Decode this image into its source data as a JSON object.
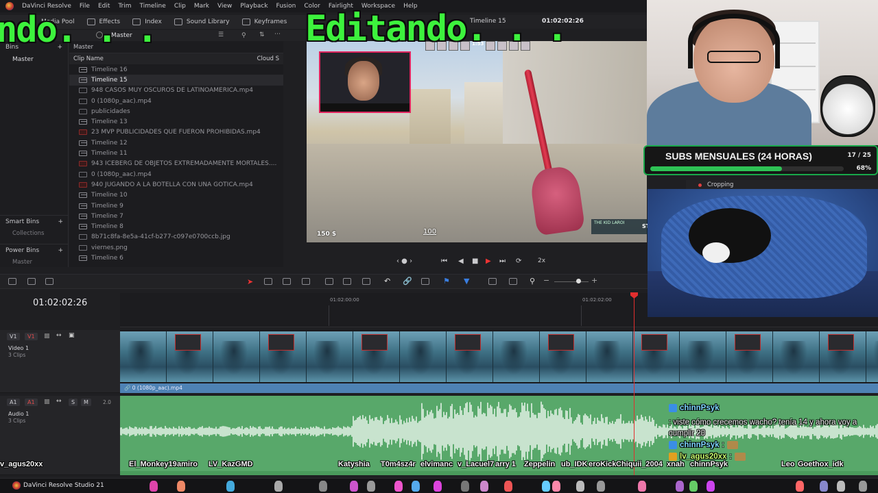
{
  "app": {
    "menu": [
      "DaVinci Resolve",
      "File",
      "Edit",
      "Trim",
      "Timeline",
      "Clip",
      "Mark",
      "View",
      "Playback",
      "Fusion",
      "Color",
      "Fairlight",
      "Workspace",
      "Help"
    ]
  },
  "toolbar": {
    "media_pool": "Media Pool",
    "effects": "Effects",
    "index": "Index",
    "sound_library": "Sound Library",
    "keyframes": "Keyframes"
  },
  "pool": {
    "header": "Master",
    "bins_label": "Bins",
    "master_bin": "Master",
    "smart_bins": "Smart Bins",
    "collections": "Collections",
    "power_bins": "Power Bins",
    "power_master": "Master",
    "crumb": "Master",
    "col_clip_name": "Clip Name",
    "col_cloud": "Cloud S",
    "clips": [
      {
        "name": "Timeline 16",
        "kind": "tl"
      },
      {
        "name": "Timeline 15",
        "kind": "tl",
        "selected": true
      },
      {
        "name": "948 CASOS MUY OSCUROS DE LATINOAMERICA.mp4",
        "kind": "vid"
      },
      {
        "name": "0 (1080p_aac).mp4",
        "kind": "vid"
      },
      {
        "name": "publicidades",
        "kind": "folder"
      },
      {
        "name": "Timeline 13",
        "kind": "tl"
      },
      {
        "name": "23 MVP PUBLICIDADES QUE FUERON PROHIBIDAS.mp4",
        "kind": "red"
      },
      {
        "name": "Timeline 12",
        "kind": "tl"
      },
      {
        "name": "Timeline 11",
        "kind": "tl"
      },
      {
        "name": "943 ICEBERG DE OBJETOS EXTREMADAMENTE MORTALES....",
        "kind": "red"
      },
      {
        "name": "0 (1080p_aac).mp4",
        "kind": "vid"
      },
      {
        "name": "940 JUGANDO A LA BOTELLA CON UNA GOTICA.mp4",
        "kind": "red"
      },
      {
        "name": "Timeline 10",
        "kind": "tl"
      },
      {
        "name": "Timeline 9",
        "kind": "tl"
      },
      {
        "name": "Timeline 7",
        "kind": "tl"
      },
      {
        "name": "Timeline 8",
        "kind": "tl"
      },
      {
        "name": "8b71c8fa-8e5a-41cf-b277-c097e0700ccb.jpg",
        "kind": "vid"
      },
      {
        "name": "viernes.png",
        "kind": "vid"
      },
      {
        "name": "Timeline 6",
        "kind": "tl"
      }
    ]
  },
  "viewer": {
    "timeline_name": "Timeline 15",
    "timecode": "01:02:02:26",
    "hud_time": "1:53",
    "money": "150 $",
    "ammo": "100",
    "killfeed": "THE KID LAROI",
    "killfeed_tag": "ST",
    "speed": "2x"
  },
  "overlay": {
    "text_left": "ndo. . .",
    "text_main": "Editando. . ."
  },
  "subs_goal": {
    "title": "SUBS MENSUALES (24 HORAS)",
    "count": "17 / 25",
    "percent_label": "68%",
    "progress": 0.68
  },
  "inspector": {
    "cropping": "Cropping"
  },
  "timeline": {
    "timecode": "01:02:02:26",
    "ruler": [
      "01:02:00:00",
      "01:02:02:00"
    ],
    "video_track": {
      "v": "V1",
      "v_red": "V1",
      "name": "Video 1",
      "clips": "3 Clips",
      "clip_label": "0 (1080p_aac).mp4"
    },
    "audio_track": {
      "a": "A1",
      "a_red": "A1",
      "name": "Audio 1",
      "clips": "3 Clips",
      "level": "2.0",
      "solo": "S",
      "mute": "M"
    }
  },
  "chat": [
    {
      "user": "chinnPsyk",
      "text": ": viste cómo crecemos wacho? tenía 14 y ahora voy a cumplir 20",
      "color": "#7fd7ff"
    },
    {
      "user": "chinnPsyk",
      "text": ":",
      "color": "#7fd7ff",
      "emote": true
    },
    {
      "user": "lv_agus20xx",
      "text": ":",
      "color": "#c8ff70",
      "emote": true
    }
  ],
  "viewers": [
    "v_agus20xx",
    "El_Monkey19",
    "amiro",
    "LV_KazGMD",
    "Katyshia",
    "T0m4sz4r",
    "elvimanc",
    "v_Lacuel7",
    "arry 1",
    "Zeppelin",
    "ub_IDK",
    "eroKick",
    "Chiquii_2004",
    "xnah",
    "chinnPsyk",
    "Leo",
    "Goethox_idk"
  ],
  "taskbar": {
    "app_name": "DaVinci Resolve Studio 21"
  }
}
